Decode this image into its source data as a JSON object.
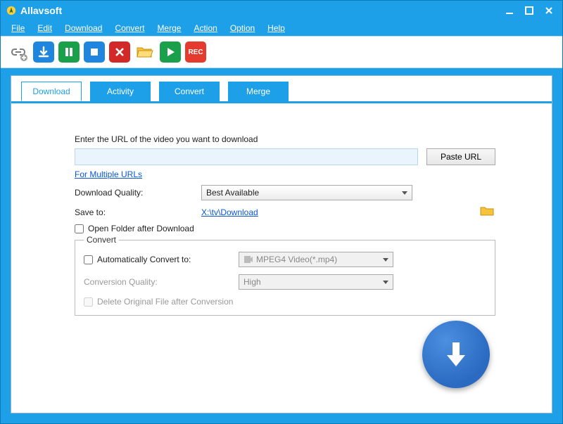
{
  "app": {
    "title": "Allavsoft"
  },
  "menu": {
    "file": "File",
    "edit": "Edit",
    "download": "Download",
    "convert": "Convert",
    "merge": "Merge",
    "action": "Action",
    "option": "Option",
    "help": "Help"
  },
  "tabs": {
    "download": "Download",
    "activity": "Activity",
    "convert": "Convert",
    "merge": "Merge"
  },
  "main": {
    "enter_url_label": "Enter the URL of the video you want to download",
    "paste_url": "Paste URL",
    "multiple_urls": "For Multiple URLs",
    "download_quality_label": "Download Quality:",
    "download_quality_value": "Best Available",
    "save_to_label": "Save to:",
    "save_to_path": "X:\\tv\\Download",
    "open_folder_label": "Open Folder after Download"
  },
  "convert": {
    "legend": "Convert",
    "auto_label": "Automatically Convert to:",
    "format_value": "MPEG4 Video(*.mp4)",
    "quality_label": "Conversion Quality:",
    "quality_value": "High",
    "delete_original_label": "Delete Original File after Conversion"
  }
}
